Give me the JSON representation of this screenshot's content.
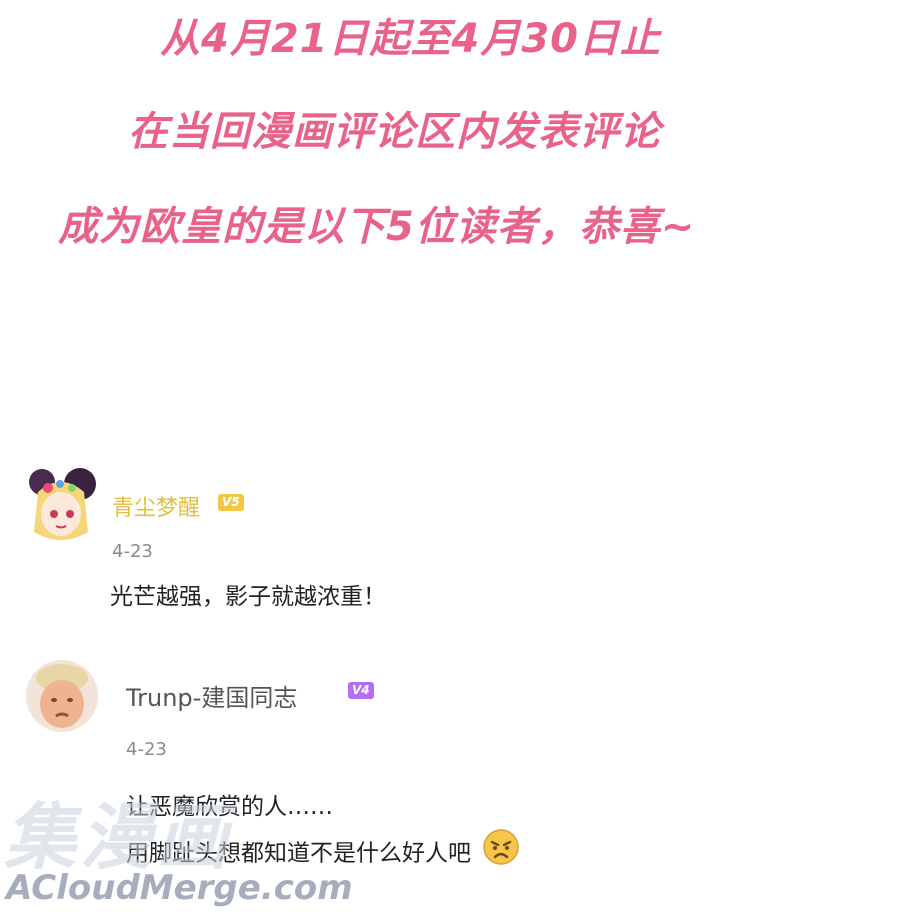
{
  "headlines": [
    "从4月21日起至4月30日止",
    "在当回漫画评论区内发表评论",
    "成为欧皇的是以下5位读者，恭喜~"
  ],
  "comments": [
    {
      "username": "青尘梦醒",
      "level": "V5",
      "date": "4-23",
      "lines": [
        "光芒越强，影子就越浓重！"
      ],
      "avatar_icon": "anime-avatar-icon"
    },
    {
      "username": "Trunp-建国同志",
      "level": "V4",
      "date": "4-23",
      "lines": [
        "让恶魔欣赏的人……",
        "用脚趾头想都知道不是什么好人吧"
      ],
      "emoji": "pouting-emoji-icon",
      "avatar_icon": "portrait-avatar-icon"
    }
  ],
  "watermark": {
    "cn": "集漫画",
    "en": "ACloudMerge.com"
  },
  "colors": {
    "headline": "#e8628a",
    "v5": "#f3c746",
    "v4": "#b46ef0"
  }
}
